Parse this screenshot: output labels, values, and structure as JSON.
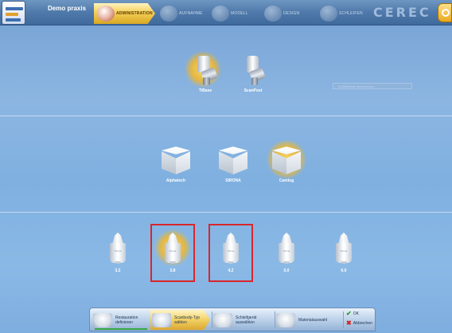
{
  "header": {
    "case_name": "Demo praxis",
    "brand": "CEREC",
    "phases": [
      {
        "label": "ADMINISTRATION",
        "active": true
      },
      {
        "label": "AUFNAHME",
        "active": false
      },
      {
        "label": "MODELL",
        "active": false
      },
      {
        "label": "DESIGN",
        "active": false
      },
      {
        "label": "SCHLEIFEN",
        "active": false
      }
    ]
  },
  "search": {
    "placeholder": "in Bibliothek durchsuchen"
  },
  "abutment_types": [
    {
      "label": "TiBase",
      "selected": true
    },
    {
      "label": "ScanPost",
      "selected": false
    }
  ],
  "manufacturers": [
    {
      "label": "Alphatech",
      "selected": false
    },
    {
      "label": "SIRONA",
      "selected": false
    },
    {
      "label": "Camlog",
      "selected": true
    }
  ],
  "scanbody_sizes": [
    {
      "label": "3.2",
      "highlighted": false
    },
    {
      "label": "3.8",
      "highlighted": true
    },
    {
      "label": "4.2",
      "highlighted": true
    },
    {
      "label": "5.0",
      "highlighted": false
    },
    {
      "label": "6.0",
      "highlighted": false
    }
  ],
  "scanbody_brand_mark": "Sirona",
  "workflow": {
    "steps": [
      {
        "label": "Restauration\ndefinieren",
        "active": false
      },
      {
        "label": "Scanbody-Typ\nwählen",
        "active": true
      },
      {
        "label": "Schleifgerät\nauswählen",
        "active": false
      },
      {
        "label": "Materialauswahl",
        "active": false
      }
    ],
    "ok_label": "OK",
    "cancel_label": "Abbrechen"
  },
  "colors": {
    "accent": "#f3cf58",
    "highlight_border": "#d9262a",
    "ok_green": "#2a9a2a",
    "cancel_red": "#d42222"
  }
}
